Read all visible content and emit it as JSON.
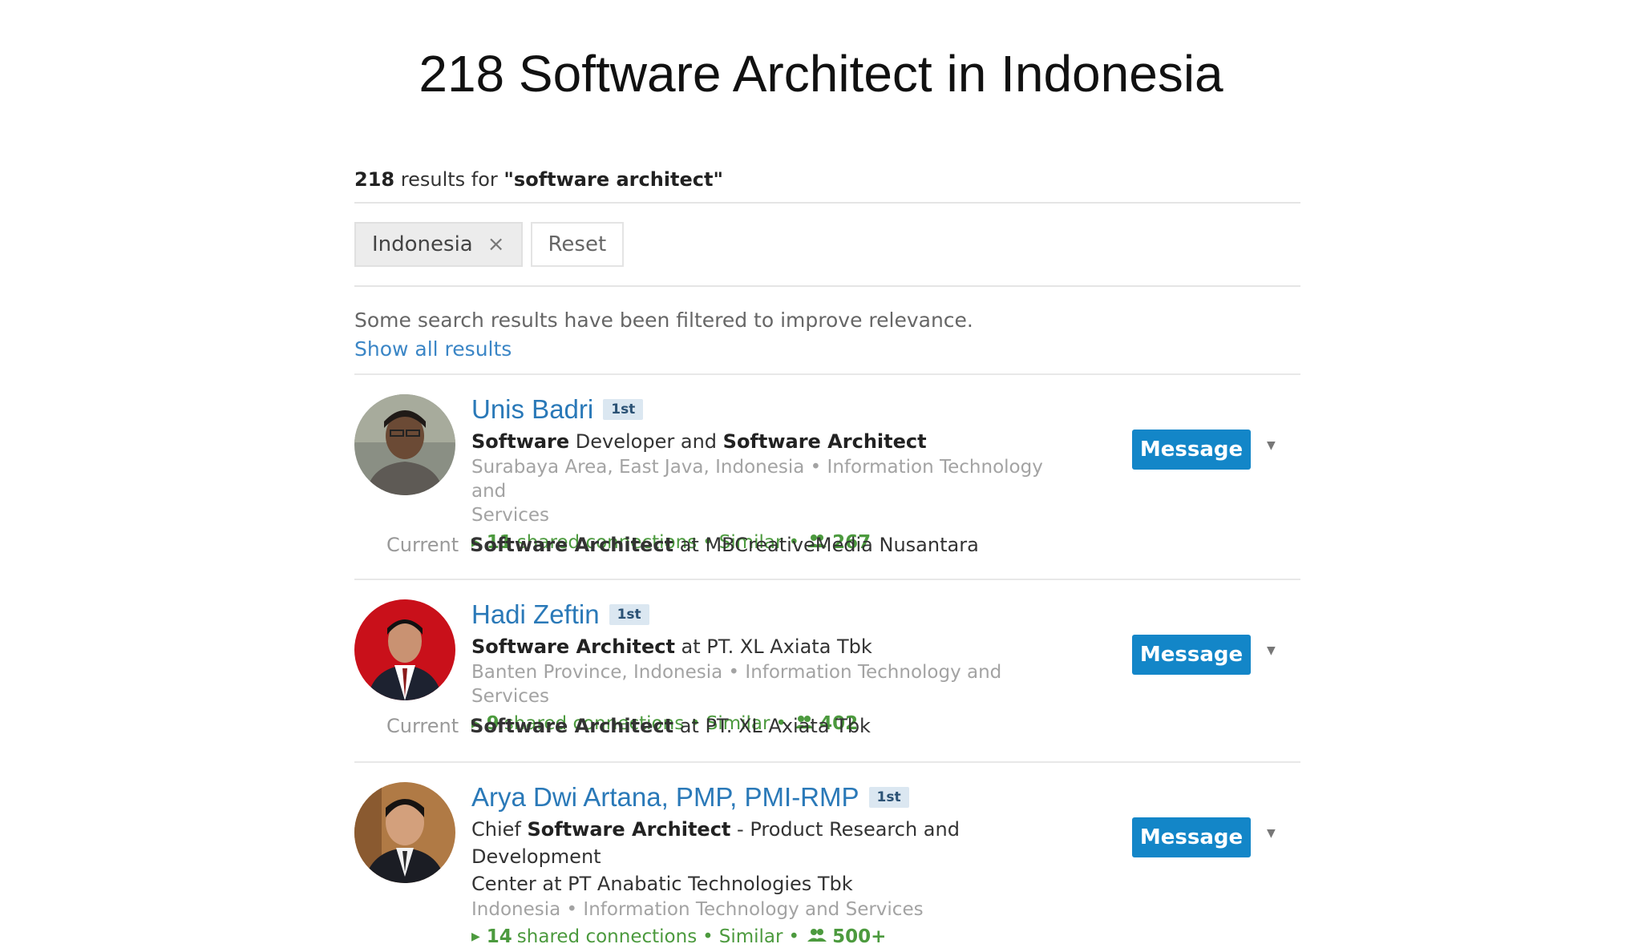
{
  "slide": {
    "title": "218 Software Architect in Indonesia"
  },
  "search": {
    "count": "218",
    "results_for": "results for",
    "query": "\"software architect\"",
    "filter_chip": "Indonesia",
    "filter_close": "×",
    "reset": "Reset",
    "notice": "Some search results have been filtered to improve relevance.",
    "show_all": "Show all results"
  },
  "labels": {
    "message": "Message",
    "current": "Current",
    "shared_connections": "shared connections",
    "similar": "Similar",
    "separator": "•"
  },
  "results": [
    {
      "name": "Unis Badri",
      "degree": "1st",
      "headline_1": "Software",
      "headline_2": " Developer and ",
      "headline_3": "Software Architect",
      "location": "Surabaya Area, East Java, Indonesia • Information Technology and",
      "location_2": "Services",
      "shared": "11",
      "connections": "267",
      "current_role": "Software Architect",
      "current_company": " at MBCreativeMedia Nusantara",
      "avatar_bg": "#8a8f84"
    },
    {
      "name": "Hadi Zeftin",
      "degree": "1st",
      "headline_1": "Software Architect",
      "headline_2": " at PT. XL Axiata Tbk",
      "location": "Banten Province, Indonesia • Information Technology and Services",
      "shared": "9",
      "connections": "402",
      "current_role": "Software Architect",
      "current_company": " at PT. XL Axiata Tbk",
      "avatar_bg": "#c9101a"
    },
    {
      "name": "Arya Dwi Artana, PMP, PMI-RMP",
      "degree": "1st",
      "headline_1": "Chief ",
      "headline_2": "Software Architect",
      "headline_3": " - Product Research and Development",
      "headline_4": "Center at PT Anabatic Technologies Tbk",
      "location": "Indonesia • Information Technology and Services",
      "shared": "14",
      "connections": "500+",
      "avatar_bg": "#b07a45"
    }
  ]
}
